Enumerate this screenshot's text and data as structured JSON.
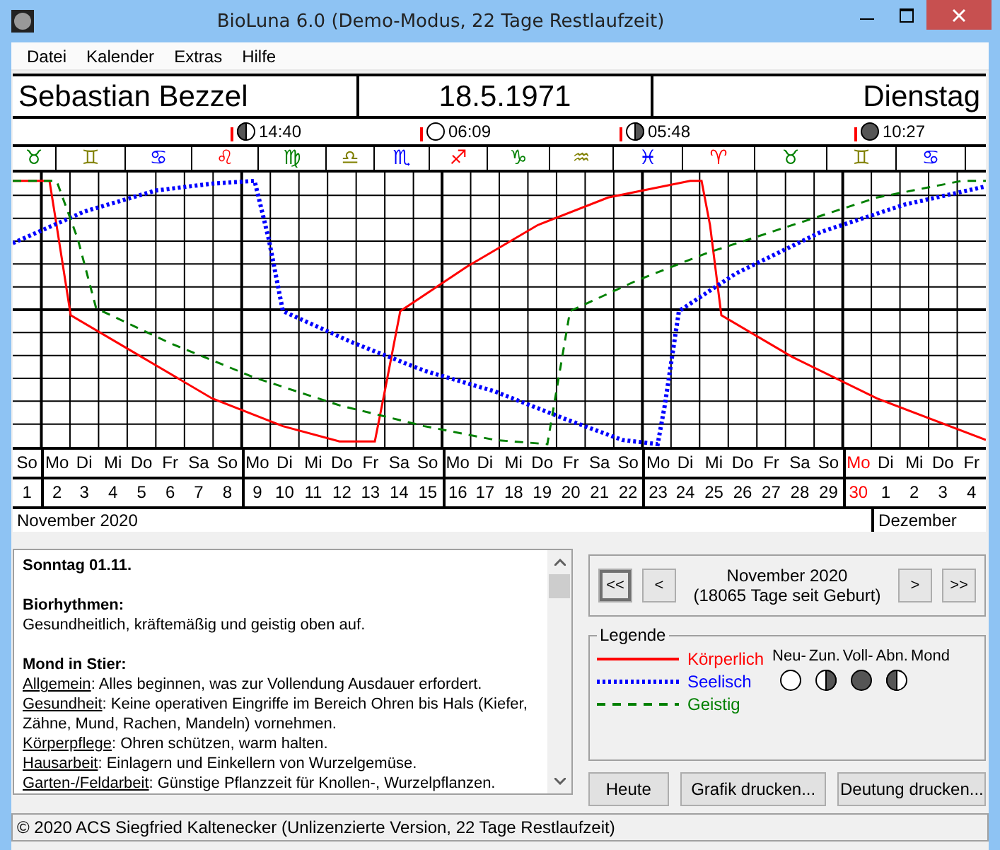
{
  "window": {
    "title": "BioLuna 6.0 (Demo-Modus, 22 Tage Restlaufzeit)"
  },
  "menu": [
    "Datei",
    "Kalender",
    "Extras",
    "Hilfe"
  ],
  "person": {
    "name": "Sebastian Bezzel",
    "birth_date": "18.5.1971",
    "weekday": "Dienstag"
  },
  "moon_phases": [
    {
      "kind": "waning",
      "time": "14:40"
    },
    {
      "kind": "new",
      "time": "06:09"
    },
    {
      "kind": "waxing",
      "time": "05:48"
    },
    {
      "kind": "full",
      "time": "10:27"
    }
  ],
  "zodiac": [
    {
      "sign": "♉",
      "color": "#008000"
    },
    {
      "sign": "♊",
      "color": "#808000"
    },
    {
      "sign": "♋",
      "color": "#0000ff"
    },
    {
      "sign": "♌",
      "color": "#ff0000"
    },
    {
      "sign": "♍",
      "color": "#008000"
    },
    {
      "sign": "♎",
      "color": "#808000"
    },
    {
      "sign": "♏",
      "color": "#0000ff"
    },
    {
      "sign": "♐",
      "color": "#ff0000"
    },
    {
      "sign": "♑",
      "color": "#008000"
    },
    {
      "sign": "♒",
      "color": "#808000"
    },
    {
      "sign": "♓",
      "color": "#0000ff"
    },
    {
      "sign": "♈",
      "color": "#ff0000"
    },
    {
      "sign": "♉",
      "color": "#008000"
    },
    {
      "sign": "♊",
      "color": "#808000"
    },
    {
      "sign": "♋",
      "color": "#0000ff"
    }
  ],
  "days": [
    {
      "weekday": "So",
      "day": "1",
      "highlighted": false
    },
    {
      "weekday": "Mo",
      "day": "2",
      "highlighted": false
    },
    {
      "weekday": "Di",
      "day": "3",
      "highlighted": false
    },
    {
      "weekday": "Mi",
      "day": "4",
      "highlighted": false
    },
    {
      "weekday": "Do",
      "day": "5",
      "highlighted": false
    },
    {
      "weekday": "Fr",
      "day": "6",
      "highlighted": false
    },
    {
      "weekday": "Sa",
      "day": "7",
      "highlighted": false
    },
    {
      "weekday": "So",
      "day": "8",
      "highlighted": false
    },
    {
      "weekday": "Mo",
      "day": "9",
      "highlighted": false
    },
    {
      "weekday": "Di",
      "day": "10",
      "highlighted": false
    },
    {
      "weekday": "Mi",
      "day": "11",
      "highlighted": false
    },
    {
      "weekday": "Do",
      "day": "12",
      "highlighted": false
    },
    {
      "weekday": "Fr",
      "day": "13",
      "highlighted": false
    },
    {
      "weekday": "Sa",
      "day": "14",
      "highlighted": false
    },
    {
      "weekday": "So",
      "day": "15",
      "highlighted": false
    },
    {
      "weekday": "Mo",
      "day": "16",
      "highlighted": false
    },
    {
      "weekday": "Di",
      "day": "17",
      "highlighted": false
    },
    {
      "weekday": "Mi",
      "day": "18",
      "highlighted": false
    },
    {
      "weekday": "Do",
      "day": "19",
      "highlighted": false
    },
    {
      "weekday": "Fr",
      "day": "20",
      "highlighted": false
    },
    {
      "weekday": "Sa",
      "day": "21",
      "highlighted": false
    },
    {
      "weekday": "So",
      "day": "22",
      "highlighted": false
    },
    {
      "weekday": "Mo",
      "day": "23",
      "highlighted": false
    },
    {
      "weekday": "Di",
      "day": "24",
      "highlighted": false
    },
    {
      "weekday": "Mi",
      "day": "25",
      "highlighted": false
    },
    {
      "weekday": "Do",
      "day": "26",
      "highlighted": false
    },
    {
      "weekday": "Fr",
      "day": "27",
      "highlighted": false
    },
    {
      "weekday": "Sa",
      "day": "28",
      "highlighted": false
    },
    {
      "weekday": "So",
      "day": "29",
      "highlighted": false
    },
    {
      "weekday": "Mo",
      "day": "30",
      "highlighted": true
    },
    {
      "weekday": "Di",
      "day": "1",
      "highlighted": false
    },
    {
      "weekday": "Mi",
      "day": "2",
      "highlighted": false
    },
    {
      "weekday": "Do",
      "day": "3",
      "highlighted": false
    },
    {
      "weekday": "Fr",
      "day": "4",
      "highlighted": false
    }
  ],
  "months": [
    "November 2020",
    "Dezember"
  ],
  "reading": {
    "heading": "Sonntag 01.11.",
    "sections": [
      {
        "title": "Biorhythmen:",
        "paragraphs": [
          {
            "text": "Gesundheitlich, kräftemäßig und geistig oben auf."
          }
        ]
      },
      {
        "title": "Mond in Stier:",
        "paragraphs": [
          {
            "topic": "Allgemein",
            "text": ": Alles beginnen, was zur Vollendung Ausdauer erfordert."
          },
          {
            "topic": "Gesundheit",
            "text": ": Keine operativen Eingriffe im Bereich Ohren bis Hals (Kiefer, Zähne, Mund, Rachen, Mandeln) vornehmen."
          },
          {
            "topic": "Körperpflege",
            "text": ": Ohren schützen, warm halten."
          },
          {
            "topic": "Hausarbeit",
            "text": ": Einlagern und Einkellern von Wurzelgemüse."
          },
          {
            "topic": "Garten-/Feldarbeit",
            "text": ": Günstige Pflanzzeit für Knollen-, Wurzelpflanzen."
          }
        ]
      }
    ]
  },
  "navigator": {
    "buttons": [
      "<<",
      "<",
      ">",
      ">>"
    ],
    "month": "November 2020",
    "days_since_birth": "(18065 Tage seit Geburt)"
  },
  "legend": {
    "title": "Legende",
    "curves": [
      {
        "kind": "solid",
        "label": "Körperlich",
        "color": "#ff0000"
      },
      {
        "kind": "dotted",
        "label": "Seelisch",
        "color": "#0000ff"
      },
      {
        "kind": "dashed",
        "label": "Geistig",
        "color": "#008000"
      }
    ],
    "moon_labels": [
      "Neu-",
      "Zun.",
      "Voll-",
      "Abn.",
      "Mond"
    ],
    "moon_symbols": [
      {
        "kind": "new"
      },
      {
        "kind": "waxing"
      },
      {
        "kind": "full"
      },
      {
        "kind": "waning"
      }
    ]
  },
  "buttons": [
    "Heute",
    "Grafik drucken...",
    "Deutung drucken..."
  ],
  "status_bar": "© 2020 ACS Siegfried Kaltenecker (Unlizenzierte Version, 22 Tage Restlaufzeit)"
}
